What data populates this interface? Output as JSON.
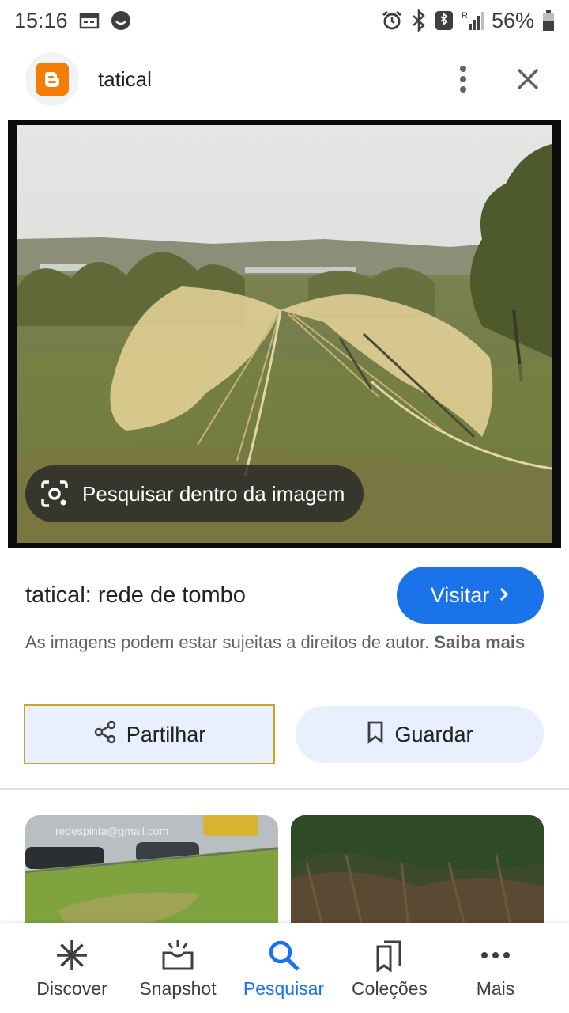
{
  "status_bar": {
    "time": "15:16",
    "battery": "56%",
    "icons": [
      "calendar-icon",
      "face-icon",
      "alarm-icon",
      "bluetooth-icon",
      "nfc-icon",
      "signal-icon",
      "battery-icon"
    ]
  },
  "header": {
    "site_name": "tatical",
    "logo_icon": "blogger-logo-icon",
    "more_icon": "more-vertical-icon",
    "close_icon": "close-icon"
  },
  "image": {
    "lens_chip_label": "Pesquisar dentro da imagem"
  },
  "result": {
    "title": "tatical: rede de tombo",
    "visit_label": "Visitar",
    "copyright_text": "As imagens podem estar sujeitas a direitos de autor.",
    "learn_more_label": "Saiba mais"
  },
  "actions": {
    "share_label": "Partilhar",
    "save_label": "Guardar"
  },
  "related": {
    "thumb1_watermark": "redespinta@gmail.com"
  },
  "bottom_nav": {
    "items": [
      {
        "label": "Discover",
        "icon": "asterisk-icon"
      },
      {
        "label": "Snapshot",
        "icon": "snapshot-icon"
      },
      {
        "label": "Pesquisar",
        "icon": "search-icon"
      },
      {
        "label": "Coleções",
        "icon": "collections-icon"
      },
      {
        "label": "Mais",
        "icon": "more-horizontal-icon"
      }
    ],
    "active": "Pesquisar"
  },
  "colors": {
    "accent": "#1a73e8",
    "chip_bg": "#e8f0fe",
    "blogger_orange": "#f57d00"
  }
}
